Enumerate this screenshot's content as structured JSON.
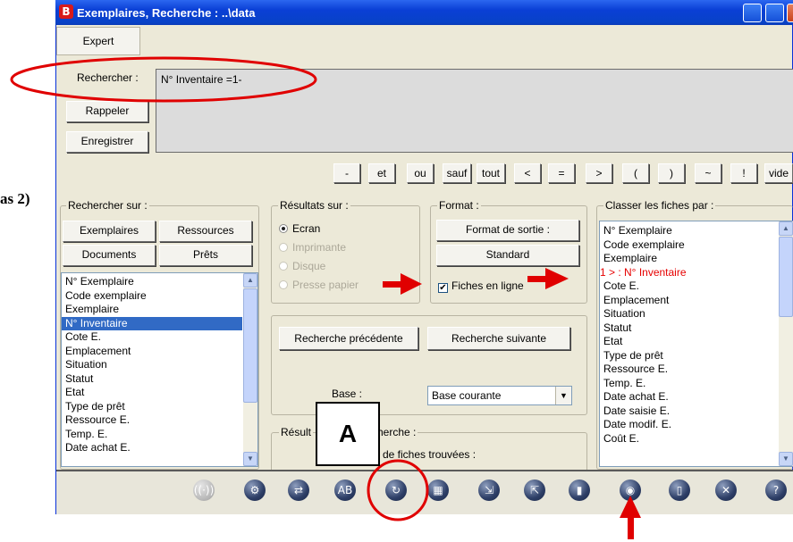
{
  "window": {
    "title": "Exemplaires, Recherche : ..\\data",
    "app_icon_letter": "B"
  },
  "menu": {
    "expert": "Expert"
  },
  "search": {
    "label": "Rechercher :",
    "query": "N° Inventaire =1-",
    "recall_button": "Rappeler",
    "save_button": "Enregistrer"
  },
  "operators": [
    "-",
    "et",
    "ou",
    "sauf",
    "tout",
    "<",
    "=",
    ">",
    "(",
    ")",
    "~",
    "!",
    "vide"
  ],
  "left_fragment": "as 2)",
  "search_on": {
    "title": "Rechercher sur :",
    "buttons": [
      "Exemplaires",
      "Ressources",
      "Documents",
      "Prêts"
    ],
    "fields": [
      "N° Exemplaire",
      "Code exemplaire",
      "Exemplaire",
      "N° Inventaire",
      "Cote E.",
      "Emplacement",
      "Situation",
      "Statut",
      "Etat",
      "Type de prêt",
      "Ressource E.",
      "Temp. E.",
      "Date achat E."
    ],
    "selected_index": 3
  },
  "results_on": {
    "title": "Résultats sur :",
    "options": [
      "Ecran",
      "Imprimante",
      "Disque",
      "Presse papier"
    ],
    "selected_index": 0
  },
  "format": {
    "title": "Format :",
    "output_button": "Format de sortie :",
    "standard": "Standard",
    "inline_label": "Fiches en ligne",
    "inline_checked": true
  },
  "navigation": {
    "previous": "Recherche précédente",
    "next": "Recherche suivante",
    "base_label": "Base :",
    "base_value": "Base courante"
  },
  "result_group": {
    "title_left": "Résult",
    "title_right": "herche :",
    "found_text": "de fiches trouvées :"
  },
  "sort_by": {
    "title": "Classer les fiches par :",
    "fields": [
      "N° Exemplaire",
      "Code exemplaire",
      "Exemplaire",
      "1 > :  N° Inventaire",
      "Cote E.",
      "Emplacement",
      "Situation",
      "Statut",
      "Etat",
      "Type de prêt",
      "Ressource E.",
      "Temp. E.",
      "Date achat E.",
      "Date saisie E.",
      "Date modif. E.",
      "Coût E."
    ],
    "highlight_index": 3
  },
  "annotation": {
    "label": "A",
    "color": "#e00000"
  },
  "toolbar_icons": [
    "radio-icon",
    "gears-icon",
    "shuffle-icon",
    "spell-check-icon",
    "refresh-icon",
    "grid-icon",
    "import-icon",
    "export-icon",
    "trash-icon",
    "eye-icon",
    "page-icon",
    "close-icon",
    "help-icon"
  ],
  "colors": {
    "title_bar": "#0a3fd5",
    "selection": "#316ac5",
    "accent_red": "#e60000"
  }
}
